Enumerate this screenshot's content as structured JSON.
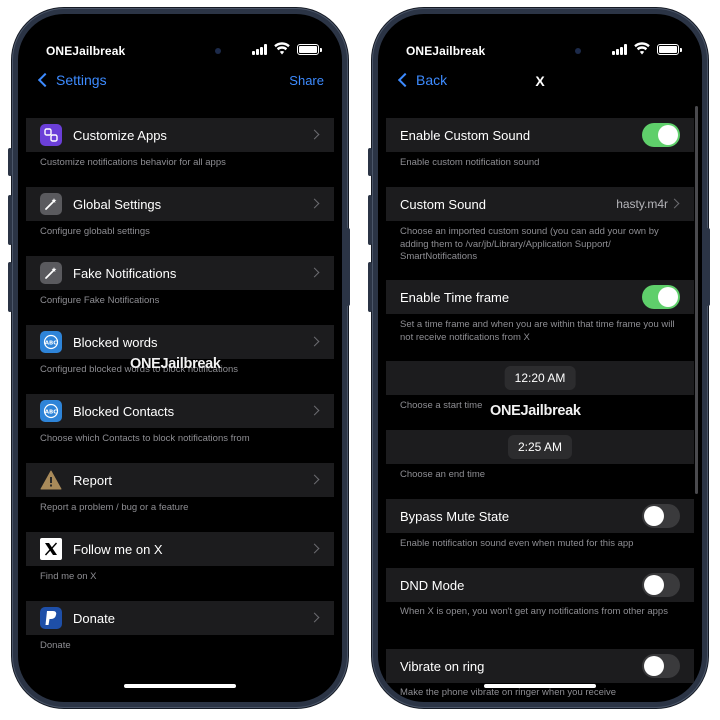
{
  "left_screen": {
    "status": {
      "carrier": "ONEJailbreak"
    },
    "nav": {
      "back_label": "Settings",
      "right_label": "Share"
    },
    "items": [
      {
        "label": "Customize Apps",
        "footer": "Customize notifications behavior for all apps",
        "icon": "apps-icon"
      },
      {
        "label": "Global Settings",
        "footer": "Configure globabl settings",
        "icon": "wand-icon"
      },
      {
        "label": "Fake Notifications",
        "footer": "Configure Fake Notifications",
        "icon": "wand-icon"
      },
      {
        "label": "Blocked words",
        "footer": "Configured blocked words to block notifications",
        "icon": "abc-icon"
      },
      {
        "label": "Blocked Contacts",
        "footer": "Choose which Contacts to block notifications from",
        "icon": "abc-icon"
      },
      {
        "label": "Report",
        "footer": "Report a problem / bug or a feature",
        "icon": "warning-icon"
      },
      {
        "label": "Follow me on X",
        "footer": "Find me on X",
        "icon": "x-logo-icon"
      },
      {
        "label": "Donate",
        "footer": "Donate",
        "icon": "paypal-icon"
      }
    ],
    "watermark": "ONEJailbreak"
  },
  "right_screen": {
    "status": {
      "carrier": "ONEJailbreak"
    },
    "nav": {
      "back_label": "Back",
      "title": "X"
    },
    "enable_custom_sound": {
      "label": "Enable Custom Sound",
      "on": true,
      "footer": "Enable custom notification sound"
    },
    "custom_sound": {
      "label": "Custom Sound",
      "value": "hasty.m4r",
      "footer": "Choose an imported custom sound (you can add your own by adding them to /var/jb/Library/Application Support/ SmartNotifications"
    },
    "enable_time_frame": {
      "label": "Enable Time frame",
      "on": true,
      "footer": "Set a time frame and when you are within that time frame you will not receive notifications from X"
    },
    "start_time": {
      "value": "12:20 AM",
      "footer": "Choose a start time"
    },
    "end_time": {
      "value": "2:25 AM",
      "footer": "Choose an end time"
    },
    "bypass_mute": {
      "label": "Bypass Mute State",
      "on": false,
      "footer": "Enable notification sound even when muted for this app"
    },
    "dnd_mode": {
      "label": "DND Mode",
      "on": false,
      "footer": "When X is open, you won't get any notifications from other apps"
    },
    "vibrate_on_ring": {
      "label": "Vibrate on ring",
      "on": false,
      "footer": "Make the phone vibrate on ringer when you receive"
    },
    "watermark": "ONEJailbreak"
  },
  "colors": {
    "accent": "#3d8bff",
    "toggle_on": "#5fcf6b",
    "row_bg": "#1c1c1e"
  }
}
